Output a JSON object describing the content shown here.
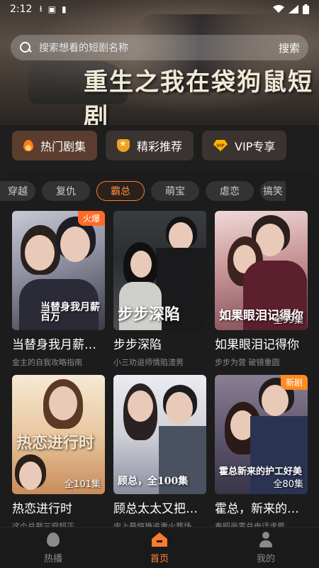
{
  "status_bar": {
    "time": "2:12"
  },
  "banner": {
    "title": "重生之我在袋狗鼠短剧"
  },
  "search": {
    "placeholder": "搜索想看的短剧名称",
    "button": "搜索"
  },
  "categories": [
    {
      "label": "热门剧集",
      "icon": "flame-icon"
    },
    {
      "label": "精彩推荐",
      "icon": "shield-star-icon"
    },
    {
      "label": "VIP专享",
      "icon": "vip-diamond-icon"
    }
  ],
  "tags": [
    "穿越",
    "复仇",
    "霸总",
    "萌宝",
    "虐恋",
    "搞笑"
  ],
  "selected_tag": "霸总",
  "dramas": [
    {
      "name": "当替身我月薪…",
      "sub": "金主的自我攻略指南",
      "badge": "火爆",
      "poster_text": "当替身我月薪百万",
      "eps": ""
    },
    {
      "name": "步步深陷",
      "sub": "小三劝退师情陷渣男",
      "badge": "",
      "poster_text": "步步深陷",
      "eps": ""
    },
    {
      "name": "如果眼泪记得你",
      "sub": "步步为营 破镜重圆",
      "badge": "",
      "poster_text": "如果眼泪记得你",
      "eps": "全99集"
    },
    {
      "name": "热恋进行时",
      "sub": "这个总裁三观超正",
      "badge": "",
      "poster_text": "热恋进行时",
      "eps": "全101集"
    },
    {
      "name": "顾总太太又把…",
      "sub": "史上最惊艳追妻火葬场",
      "badge": "",
      "poster_text": "顾总，全100集",
      "eps": "全100集"
    },
    {
      "name": "霍总，新来的…",
      "sub": "秦昭画霍总电话求爱",
      "badge": "新剧",
      "poster_text": "霍总新来的护工好美",
      "eps": "全80集"
    }
  ],
  "bottom_nav": [
    {
      "label": "热播",
      "icon": "fire-icon"
    },
    {
      "label": "首页",
      "icon": "home-icon"
    },
    {
      "label": "我的",
      "icon": "user-icon"
    }
  ]
}
